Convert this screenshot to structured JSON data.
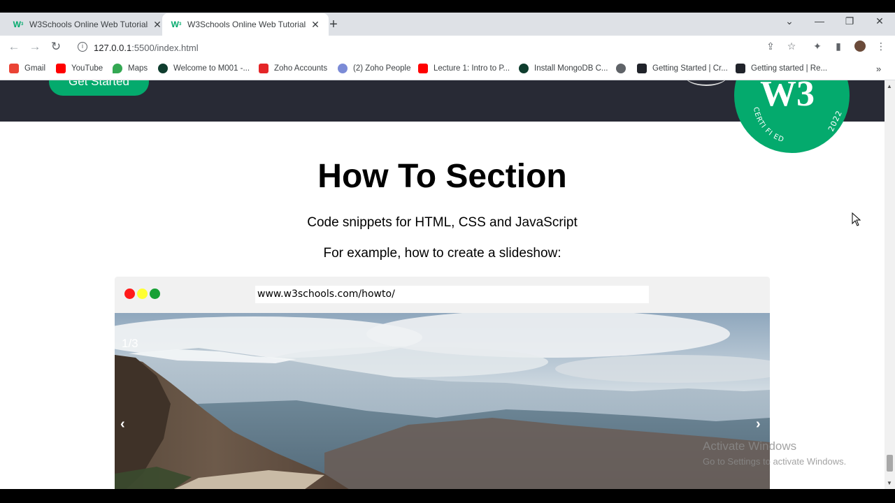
{
  "browser": {
    "tabs": [
      {
        "label": "W3Schools Online Web Tutorials",
        "active": false
      },
      {
        "label": "W3Schools Online Web Tutorials",
        "active": true
      }
    ],
    "url_host": "127.0.0.1",
    "url_rest": ":5500/index.html",
    "bookmarks": [
      {
        "label": "Gmail",
        "icon": "gmail-icon",
        "color": "#ea4335"
      },
      {
        "label": "YouTube",
        "icon": "youtube-icon",
        "color": "#ff0000"
      },
      {
        "label": "Maps",
        "icon": "maps-icon",
        "color": "#34a853"
      },
      {
        "label": "Welcome to M001 -...",
        "icon": "mongodb-icon",
        "color": "#0f3d2e"
      },
      {
        "label": "Zoho Accounts",
        "icon": "zoho-icon",
        "color": "#e42527"
      },
      {
        "label": "(2) Zoho People",
        "icon": "zoho-people-icon",
        "color": "#7b8bd6"
      },
      {
        "label": "Lecture 1: Intro to P...",
        "icon": "youtube-icon",
        "color": "#ff0000"
      },
      {
        "label": "Install MongoDB C...",
        "icon": "mongodb-icon",
        "color": "#0f3d2e"
      },
      {
        "label": "",
        "icon": "globe-icon",
        "color": "#5f6368"
      },
      {
        "label": "Getting Started | Cr...",
        "icon": "react-icon",
        "color": "#20232a"
      },
      {
        "label": "Getting started | Re...",
        "icon": "react-icon",
        "color": "#20232a"
      }
    ]
  },
  "hero": {
    "button_label": "Get Started",
    "badge_text": "W3",
    "badge_arc": "CERTI FI ED",
    "badge_year": "2022"
  },
  "section": {
    "title": "How To Section",
    "subtitle": "Code snippets for HTML, CSS and JavaScript",
    "example": "For example, how to create a slideshow:"
  },
  "demo": {
    "url": "www.w3schools.com/howto/",
    "counter": "1/3",
    "prev": "‹",
    "next": "›",
    "dot_colors": [
      "#ff1a1a",
      "#ffff33",
      "#16a034"
    ]
  },
  "watermark": {
    "line1": "Activate Windows",
    "line2": "Go to Settings to activate Windows."
  }
}
